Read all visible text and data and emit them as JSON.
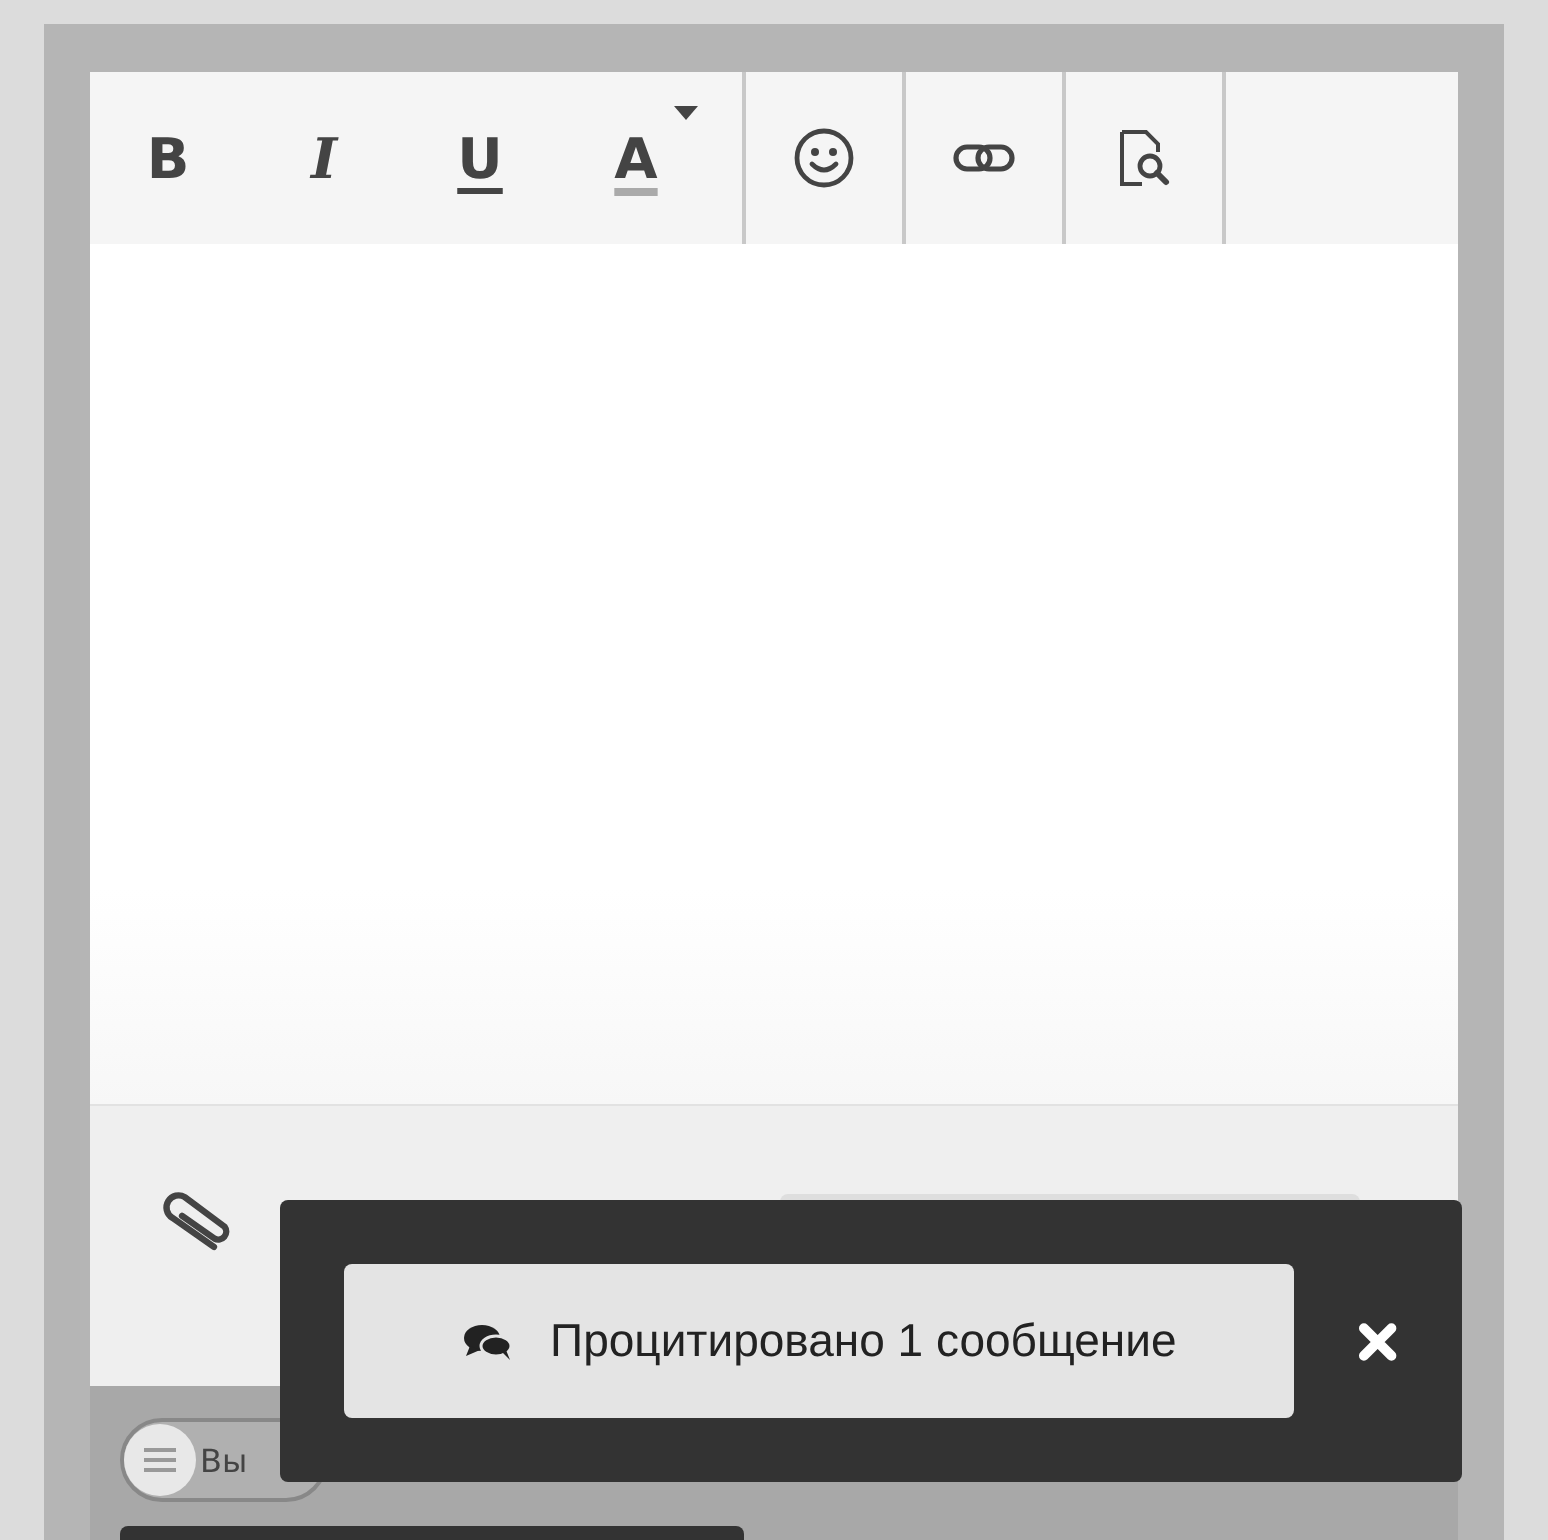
{
  "toolbar": {
    "format_buttons": [
      {
        "label": "B",
        "kind": "bold"
      },
      {
        "label": "I",
        "kind": "italic"
      },
      {
        "label": "U",
        "kind": "underline"
      },
      {
        "label": "A",
        "kind": "color"
      }
    ],
    "icon_buttons": [
      {
        "kind": "emoji"
      },
      {
        "kind": "link"
      },
      {
        "kind": "preview"
      }
    ]
  },
  "footer": {
    "toggle": {
      "label": "Вы",
      "on": false
    }
  },
  "toast": {
    "message": "Процитировано 1 сообщение"
  }
}
